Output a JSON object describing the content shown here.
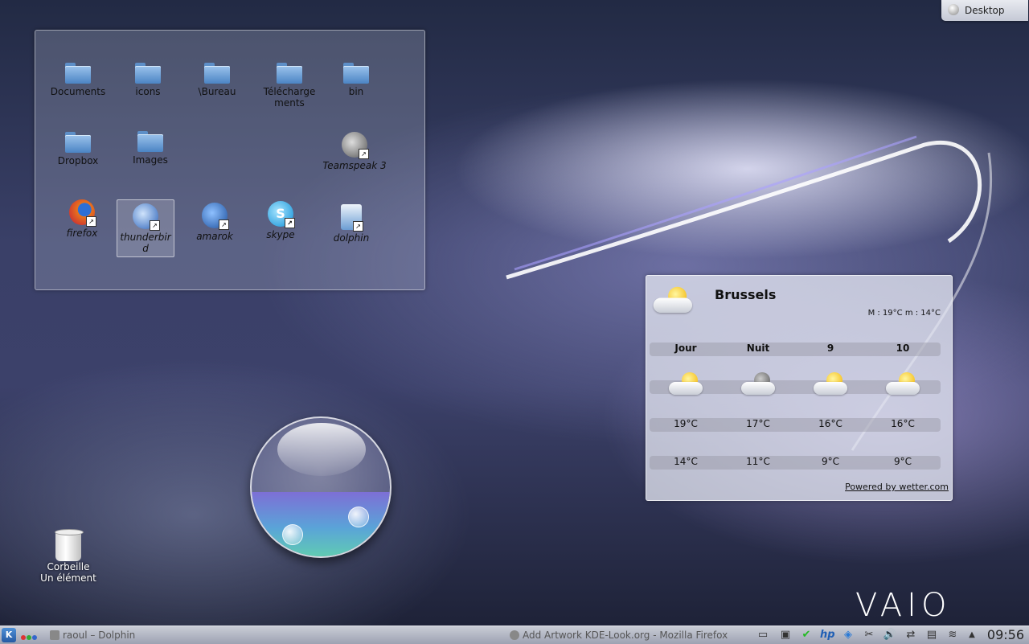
{
  "desktop_toolbox": {
    "label": "Desktop"
  },
  "folderview": {
    "items": [
      {
        "label": "Documents",
        "type": "folder"
      },
      {
        "label": "icons",
        "type": "folder"
      },
      {
        "label": "\\Bureau",
        "type": "folder"
      },
      {
        "label": "Télécharge ments",
        "type": "folder"
      },
      {
        "label": "bin",
        "type": "folder"
      },
      {
        "label": "Dropbox",
        "type": "folder"
      },
      {
        "label": "Images",
        "type": "folder"
      },
      {
        "label": "Teamspeak 3",
        "type": "shortcut"
      },
      {
        "label": "firefox",
        "type": "shortcut"
      },
      {
        "label": "thunderbird",
        "type": "shortcut"
      },
      {
        "label": "amarok",
        "type": "shortcut"
      },
      {
        "label": "skype",
        "type": "shortcut"
      },
      {
        "label": "dolphin",
        "type": "shortcut"
      }
    ]
  },
  "weather": {
    "city": "Brussels",
    "minmax": "M : 19°C m : 14°C",
    "columns": [
      "Jour",
      "Nuit",
      "9",
      "10"
    ],
    "highs": [
      "19°C",
      "17°C",
      "16°C",
      "16°C"
    ],
    "lows": [
      "14°C",
      "11°C",
      "9°C",
      "9°C"
    ],
    "powered": "Powered by wetter.com"
  },
  "trash": {
    "line1": "Corbeille",
    "line2": "Un élément"
  },
  "brand": "VAIO",
  "taskbar": {
    "tasks": [
      "raoul – Dolphin",
      "Add  Artwork KDE-Look.org - Mozilla Firefox"
    ],
    "clock": "09:56"
  }
}
